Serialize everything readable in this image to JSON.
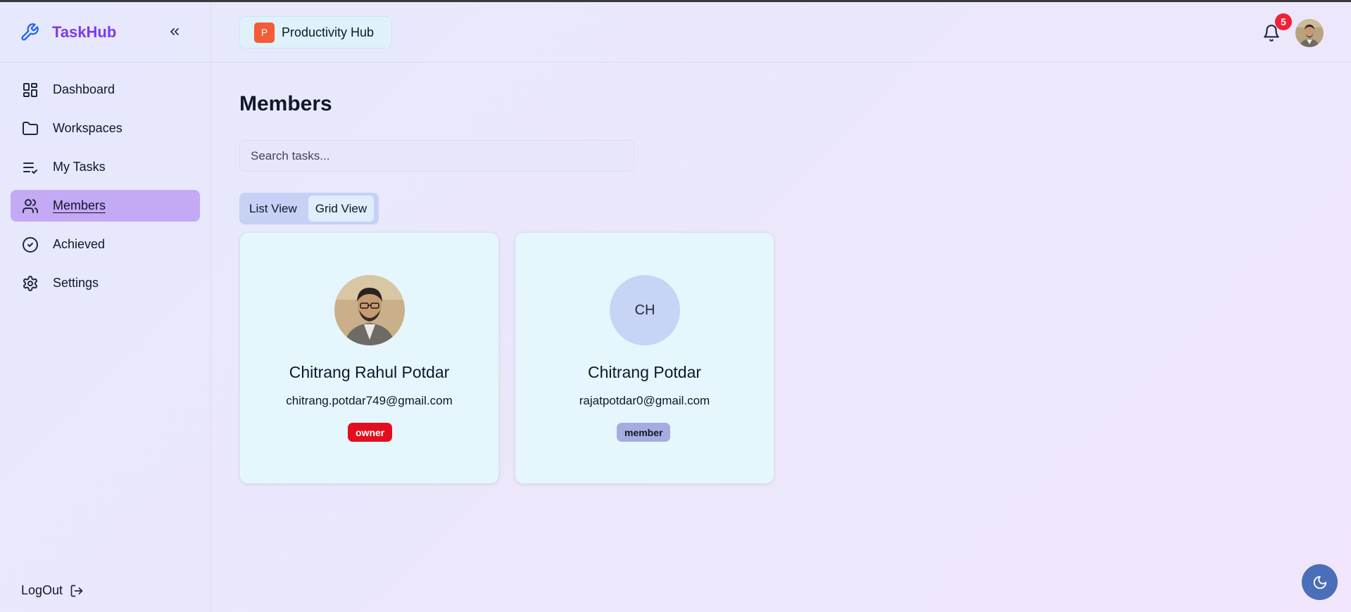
{
  "app": {
    "name": "TaskHub"
  },
  "sidebar": {
    "items": [
      {
        "label": "Dashboard",
        "icon": "dashboard-icon"
      },
      {
        "label": "Workspaces",
        "icon": "folder-icon"
      },
      {
        "label": "My Tasks",
        "icon": "list-check-icon"
      },
      {
        "label": "Members",
        "icon": "users-icon",
        "active": true
      },
      {
        "label": "Achieved",
        "icon": "check-circle-icon"
      },
      {
        "label": "Settings",
        "icon": "gear-icon"
      }
    ],
    "logout_label": "LogOut"
  },
  "header": {
    "workspace_initial": "P",
    "workspace_name": "Productivity Hub",
    "notification_count": "5"
  },
  "main": {
    "title": "Members",
    "search_placeholder": "Search tasks...",
    "views": [
      "List View",
      "Grid View"
    ],
    "active_view": "Grid View",
    "members": [
      {
        "name": "Chitrang Rahul Potdar",
        "email": "chitrang.potdar749@gmail.com",
        "role": "owner",
        "avatar": "photo"
      },
      {
        "name": "Chitrang Potdar",
        "email": "rajatpotdar0@gmail.com",
        "role": "member",
        "initials": "CH"
      }
    ]
  },
  "colors": {
    "brand": "#7c3aed",
    "active_nav": "#c4a9f5",
    "owner_badge": "#e30f1f",
    "member_badge": "#a6ace0",
    "notification_badge": "#ef2236"
  }
}
